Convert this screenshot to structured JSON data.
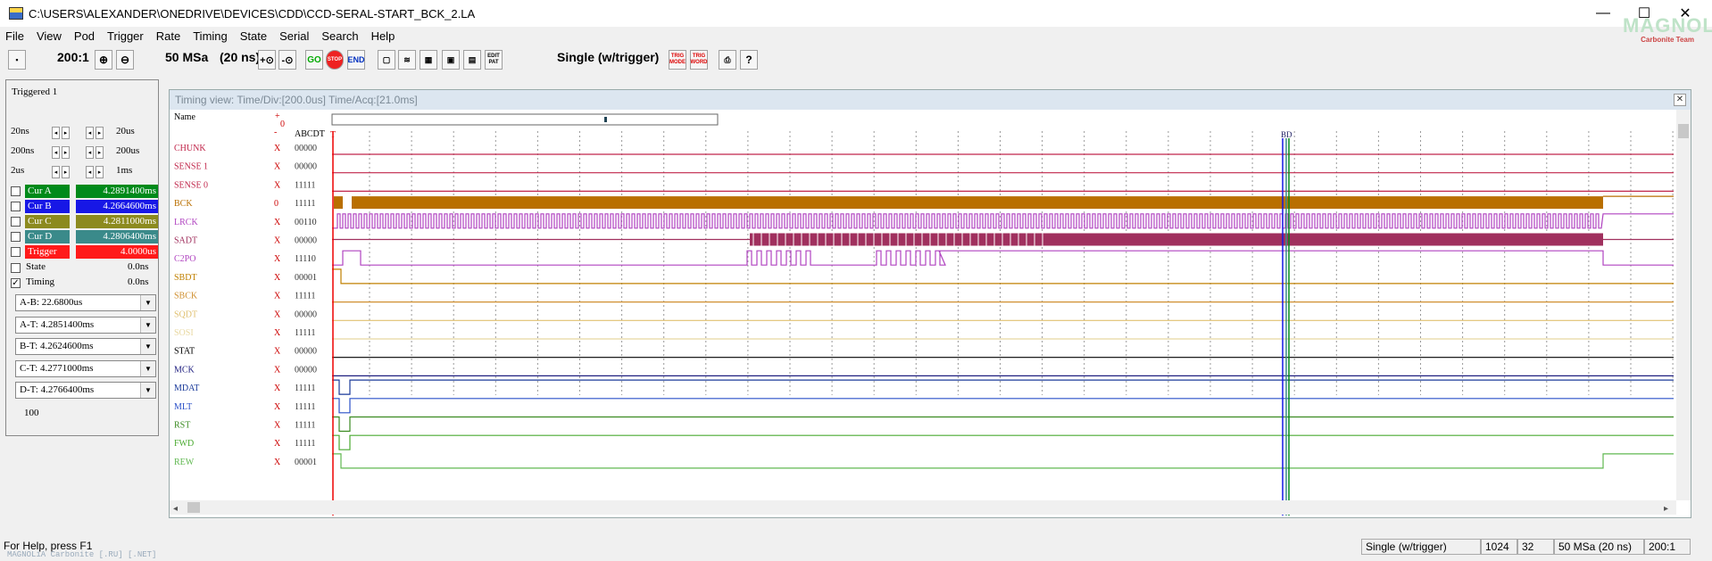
{
  "window": {
    "title": "C:\\USERS\\ALEXANDER\\ONEDRIVE\\DEVICES\\CDD\\CCD-SERAL-START_BCK_2.LA",
    "logo": "MAGNOLIA",
    "logo_sub": "Carbonite Team",
    "minimize": "—",
    "maximize": "☐",
    "close": "✕"
  },
  "menu": [
    "File",
    "View",
    "Pod",
    "Trigger",
    "Rate",
    "Timing",
    "State",
    "Serial",
    "Search",
    "Help"
  ],
  "toolbar": {
    "zoom_level": "200:1",
    "rate": "50 MSa",
    "sample_period": "(20 ns)",
    "mode": "Single (w/trigger)",
    "go": "GO",
    "stop": "STOP",
    "end": "END",
    "edit_pat": "EDIT PAT",
    "trig_mode": "TRIG MODE",
    "trig_word": "TRIG WORD"
  },
  "left": {
    "status": "Triggered 1",
    "time_left": [
      "20ns",
      "200ns",
      "2us"
    ],
    "time_right": [
      "20us",
      "200us",
      "1ms"
    ],
    "cursors": [
      {
        "label": "Cur A",
        "value": "4.2891400ms",
        "color": "#008a1a"
      },
      {
        "label": "Cur B",
        "value": "4.2664600ms",
        "color": "#1717e6"
      },
      {
        "label": "Cur C",
        "value": "4.2811000ms",
        "color": "#8c8a1e"
      },
      {
        "label": "Cur D",
        "value": "4.2806400ms",
        "color": "#3a8a8a"
      },
      {
        "label": "Trigger",
        "value": "4.0000us",
        "color": "#ff1a1a"
      }
    ],
    "state_label": "State",
    "state_value": "0.0ns",
    "timing_label": "Timing",
    "timing_value": "0.0ns",
    "measurements": [
      "A-B: 22.6800us",
      "A-T: 4.2851400ms",
      "B-T: 4.2624600ms",
      "C-T: 4.2771000ms",
      "D-T: 4.2766400ms"
    ],
    "count": "100"
  },
  "timing": {
    "header": "Timing view:  Time/Div:[200.0us]  Time/Acq:[21.0ms]",
    "name_col": "Name",
    "plus": "+",
    "zero": "0",
    "minus": "-",
    "col_header": "ABCDT",
    "trigger_mark": "T",
    "cursor_mark": "BD",
    "channels": [
      {
        "name": "CHUNK",
        "x": "X",
        "bits": "00000",
        "color": "#c0254a"
      },
      {
        "name": "SENSE 1",
        "x": "X",
        "bits": "00000",
        "color": "#c0254a"
      },
      {
        "name": "SENSE 0",
        "x": "X",
        "bits": "11111",
        "color": "#c0254a"
      },
      {
        "name": "BCK",
        "x": "0",
        "bits": "11111",
        "color": "#b96f00"
      },
      {
        "name": "LRCK",
        "x": "X",
        "bits": "00110",
        "color": "#b043c0"
      },
      {
        "name": "SADT",
        "x": "X",
        "bits": "00000",
        "color": "#a0305e"
      },
      {
        "name": "C2PO",
        "x": "X",
        "bits": "11110",
        "color": "#b043c0"
      },
      {
        "name": "SBDT",
        "x": "X",
        "bits": "00001",
        "color": "#c08000"
      },
      {
        "name": "SBCK",
        "x": "X",
        "bits": "11111",
        "color": "#d09030"
      },
      {
        "name": "SQDT",
        "x": "X",
        "bits": "00000",
        "color": "#e0c070"
      },
      {
        "name": "SOSI",
        "x": "X",
        "bits": "11111",
        "color": "#e8d8a0"
      },
      {
        "name": "STAT",
        "x": "X",
        "bits": "00000",
        "color": "#000000"
      },
      {
        "name": "MCK",
        "x": "X",
        "bits": "00000",
        "color": "#202080"
      },
      {
        "name": "MDAT",
        "x": "X",
        "bits": "11111",
        "color": "#1a3a9a"
      },
      {
        "name": "MLT",
        "x": "X",
        "bits": "11111",
        "color": "#2a50c8"
      },
      {
        "name": "RST",
        "x": "X",
        "bits": "11111",
        "color": "#3a8a20"
      },
      {
        "name": "FWD",
        "x": "X",
        "bits": "11111",
        "color": "#4aaa30"
      },
      {
        "name": "REW",
        "x": "X",
        "bits": "00001",
        "color": "#60b850"
      }
    ]
  },
  "status": {
    "help": "For Help, press F1",
    "footer": "MAGNOLiA Carbonite [.RU] [.NET]",
    "mode": "Single (w/trigger)",
    "depth": "1024",
    "width": "32",
    "rate": "50 MSa (20 ns)",
    "zoom": "200:1"
  }
}
